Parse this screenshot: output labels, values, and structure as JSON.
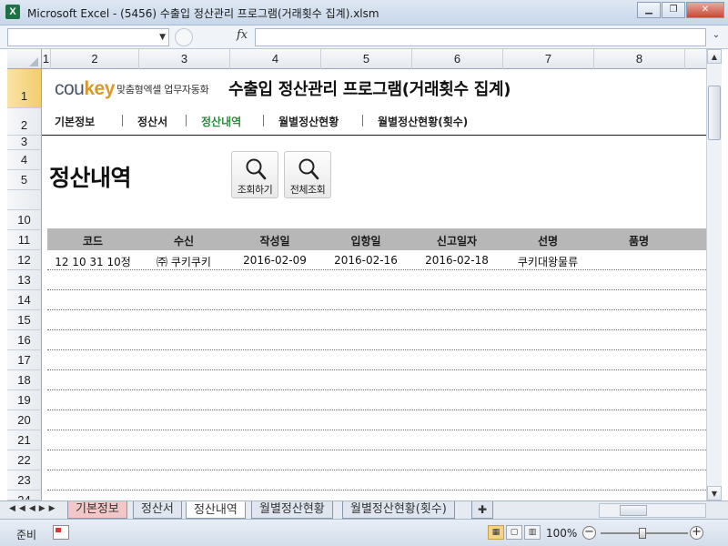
{
  "window": {
    "app_icon_letter": "X",
    "title": "Microsoft Excel - (5456) 수출입 정산관리 프로그램(거래횟수 집계).xlsm",
    "controls": {
      "minimize": "▁",
      "restore": "❐",
      "close": "✕"
    }
  },
  "formula_bar": {
    "name_box_value": "",
    "fx_label": "fx",
    "formula_value": ""
  },
  "columns": [
    "1",
    "2",
    "3",
    "4",
    "5",
    "6",
    "7",
    "8"
  ],
  "rows": [
    "1",
    "2",
    "3",
    "4",
    "5",
    "10",
    "11",
    "12",
    "13",
    "14",
    "15",
    "16",
    "17",
    "18",
    "19",
    "20",
    "21",
    "22",
    "23",
    "24"
  ],
  "header": {
    "brand_cou": "cou",
    "brand_key": "key",
    "brand_sub": "맞춤형엑셀 업무자동화",
    "app_title": "수출입 정산관리 프로그램(거래횟수 집계)"
  },
  "nav": {
    "items": [
      {
        "label": "기본정보",
        "active": false
      },
      {
        "label": "정산서",
        "active": false
      },
      {
        "label": "정산내역",
        "active": true
      },
      {
        "label": "월별정산현황",
        "active": false
      },
      {
        "label": "월별정산현황(횟수)",
        "active": false
      }
    ]
  },
  "section_title": "정산내역",
  "buttons": {
    "search": "조회하기",
    "search_all": "전체조회"
  },
  "table": {
    "headers": [
      "코드",
      "수신",
      "작성일",
      "입항일",
      "신고일자",
      "선명",
      "품명"
    ],
    "rows": [
      [
        "12 10 31 10정",
        "㈜ 쿠키쿠키",
        "2016-02-09",
        "2016-02-16",
        "2016-02-18",
        "쿠키대왕물류",
        ""
      ]
    ]
  },
  "sheet_tabs": {
    "items": [
      {
        "label": "기본정보",
        "style": "pink"
      },
      {
        "label": "정산서",
        "style": "normal"
      },
      {
        "label": "정산내역",
        "style": "active"
      },
      {
        "label": "월별정산현황",
        "style": "normal"
      },
      {
        "label": "월별정산현황(횟수)",
        "style": "normal"
      }
    ]
  },
  "status": {
    "ready": "준비",
    "zoom": "100%",
    "zoom_percent": 100
  }
}
